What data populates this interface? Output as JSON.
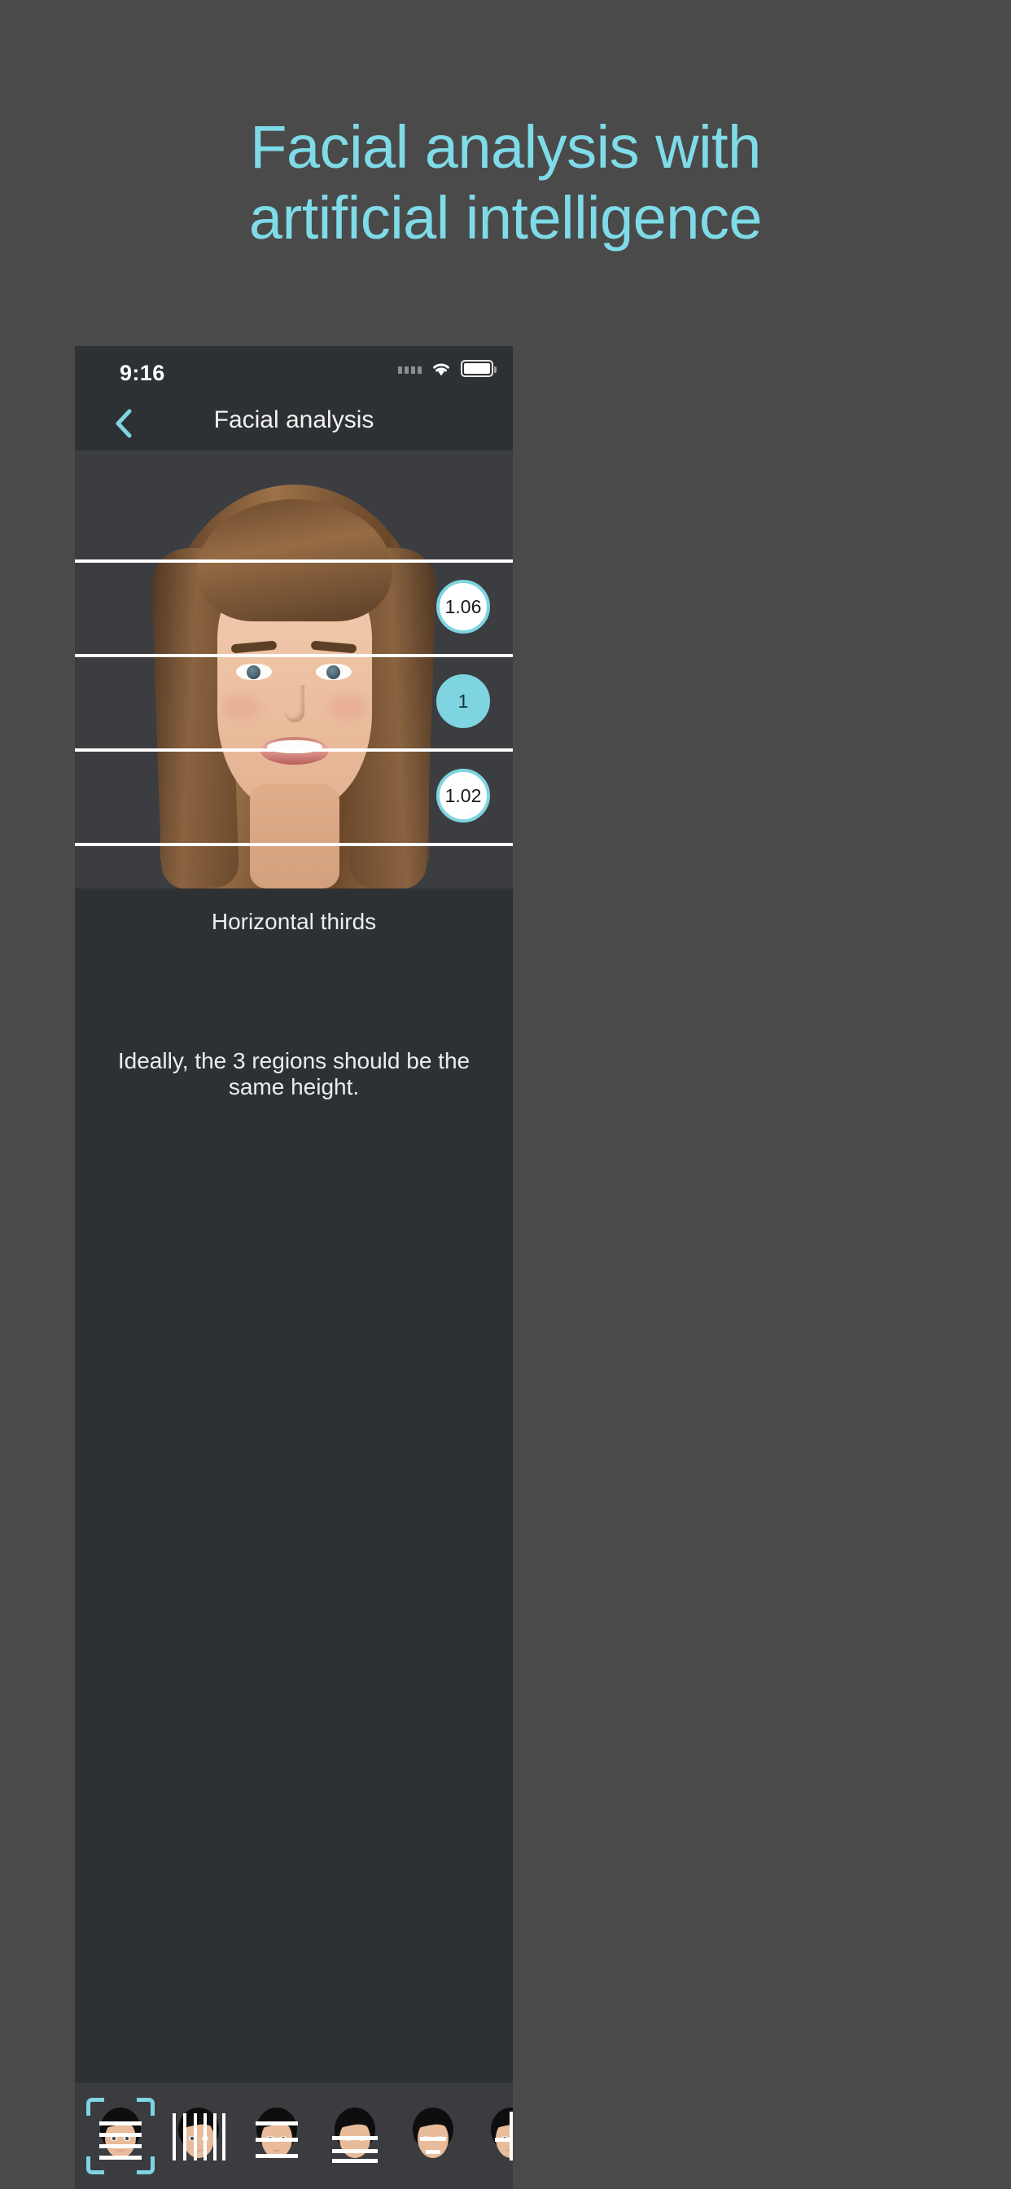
{
  "promo": {
    "headline_line1": "Facial analysis with",
    "headline_line2": "artificial intelligence",
    "accent_color": "#7fdbe8",
    "background_color": "#4a4a4a"
  },
  "status_bar": {
    "time": "9:16",
    "signal_icon": "signal-dots-icon",
    "wifi_icon": "wifi-icon",
    "battery_icon": "battery-icon"
  },
  "nav_bar": {
    "back_icon": "chevron-left-icon",
    "title": "Facial analysis"
  },
  "analysis": {
    "photo_alt": "front-facing portrait photo of a smiling woman",
    "guide_line_color": "#ffffff",
    "badges": [
      {
        "value": "1.06",
        "style": "outline"
      },
      {
        "value": "1",
        "style": "filled"
      },
      {
        "value": "1.02",
        "style": "outline"
      }
    ]
  },
  "info": {
    "title": "Horizontal thirds",
    "description": "Ideally, the 3 regions should be the same height."
  },
  "toolbar": {
    "selected_index": 0,
    "items": [
      {
        "icon": "face-horizontal-thirds-icon",
        "selected": true
      },
      {
        "icon": "face-vertical-fifths-icon",
        "selected": false
      },
      {
        "icon": "face-horizontal-lines-icon",
        "selected": false
      },
      {
        "icon": "face-lower-thirds-icon",
        "selected": false
      },
      {
        "icon": "face-eye-mouth-icon",
        "selected": false
      },
      {
        "icon": "face-midline-icon",
        "selected": false
      }
    ]
  }
}
